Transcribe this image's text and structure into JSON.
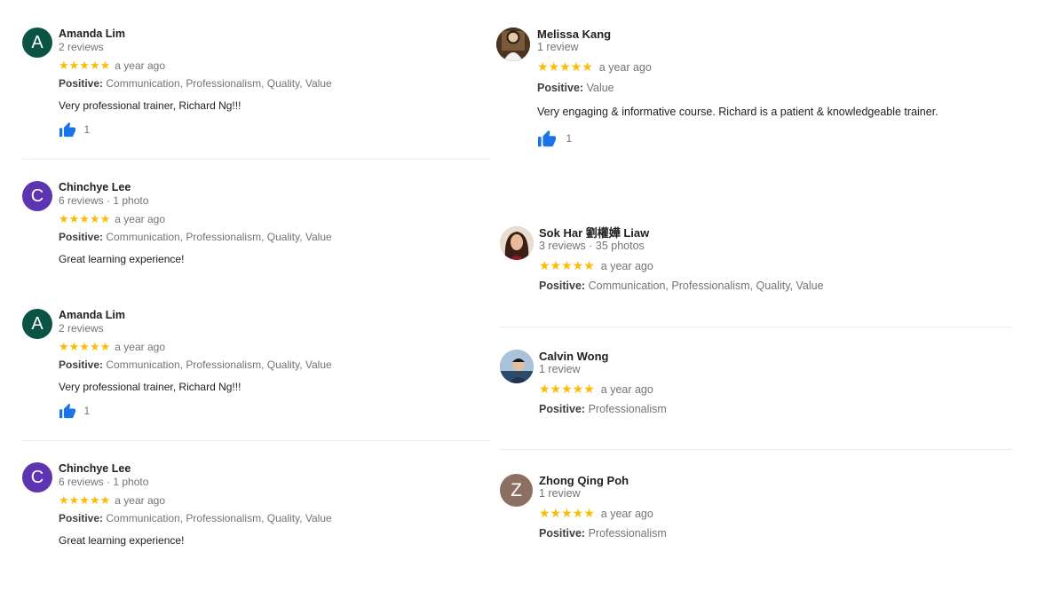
{
  "reviews": [
    {
      "name": "Amanda Lim",
      "meta": "2 reviews",
      "stars": "★★★★★",
      "ago": "a year ago",
      "positive_label": "Positive:",
      "positive_values": "Communication, Professionalism, Quality, Value",
      "text": "Very professional trainer, Richard Ng!!!",
      "likes": "1",
      "avatar_letter": "A",
      "avatar_color": "#0b5345"
    },
    {
      "name": "Chinchye Lee",
      "meta": "6 reviews · 1 photo",
      "stars": "★★★★★",
      "ago": "a year ago",
      "positive_label": "Positive:",
      "positive_values": "Communication, Professionalism, Quality, Value",
      "text": "Great learning experience!",
      "avatar_letter": "C",
      "avatar_color": "#5e35b1"
    },
    {
      "name": "Amanda Lim",
      "meta": "2 reviews",
      "stars": "★★★★★",
      "ago": "a year ago",
      "positive_label": "Positive:",
      "positive_values": "Communication, Professionalism, Quality, Value",
      "text": "Very professional trainer, Richard Ng!!!",
      "likes": "1",
      "avatar_letter": "A",
      "avatar_color": "#0b5345"
    },
    {
      "name": "Chinchye Lee",
      "meta": "6 reviews · 1 photo",
      "stars": "★★★★★",
      "ago": "a year ago",
      "positive_label": "Positive:",
      "positive_values": "Communication, Professionalism, Quality, Value",
      "text": "Great learning experience!",
      "avatar_letter": "C",
      "avatar_color": "#5e35b1"
    },
    {
      "name": "Melissa Kang",
      "meta": "1 review",
      "stars": "★★★★★",
      "ago": "a year ago",
      "positive_label": "Positive:",
      "positive_values": "Value",
      "text": "Very engaging & informative course. Richard is a  patient & knowledgeable trainer.",
      "likes": "1"
    },
    {
      "name": "Sok Har 劉權嬅 Liaw",
      "meta": "3 reviews · 35 photos",
      "stars": "★★★★★",
      "ago": "a year ago",
      "positive_label": "Positive:",
      "positive_values": "Communication, Professionalism, Quality, Value"
    },
    {
      "name": "Calvin Wong",
      "meta": "1 review",
      "stars": "★★★★★",
      "ago": "a year ago",
      "positive_label": "Positive:",
      "positive_values": "Professionalism"
    },
    {
      "name": "Zhong Qing Poh",
      "meta": "1 review",
      "stars": "★★★★★",
      "ago": "a year ago",
      "positive_label": "Positive:",
      "positive_values": "Professionalism",
      "avatar_letter": "Z",
      "avatar_color": "#8d6e63"
    }
  ],
  "colors": {
    "star": "#fbbc04",
    "like": "#1a73e8",
    "divider": "#e8eaed"
  },
  "icons": {
    "like": "thumbs-up-icon",
    "star": "star-icon"
  }
}
